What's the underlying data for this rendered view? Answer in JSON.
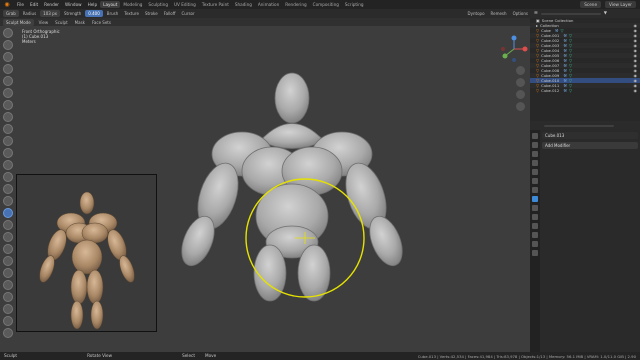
{
  "topbar": {
    "menus": [
      "File",
      "Edit",
      "Render",
      "Window",
      "Help"
    ],
    "workspaces": [
      "Layout",
      "Modeling",
      "Sculpting",
      "UV Editing",
      "Texture Paint",
      "Shading",
      "Animation",
      "Rendering",
      "Compositing",
      "Scripting"
    ],
    "active_workspace": "Layout",
    "scene": "Scene",
    "view_layer": "View Layer"
  },
  "tool_header": {
    "brush": "Grab",
    "radius_label": "Radius",
    "radius_value": "103 px",
    "strength_label": "Strength",
    "strength_value": "0.400",
    "menus": [
      "Brush",
      "Texture",
      "Stroke",
      "Falloff",
      "Cursor"
    ],
    "right": [
      "Dyntopo",
      "Remesh",
      "Options"
    ]
  },
  "viewport_header": {
    "mode": "Sculpt Mode",
    "menus": [
      "View",
      "Sculpt",
      "Mask",
      "Face Sets"
    ]
  },
  "viewport": {
    "view_name": "Front Orthographic",
    "object_name": "(1) Cube.013",
    "units": "Meters"
  },
  "outliner": {
    "header_search": "",
    "rows": [
      {
        "name": "Scene Collection",
        "type": "scene"
      },
      {
        "name": "Collection",
        "type": "collection"
      },
      {
        "name": "Cube",
        "type": "mesh"
      },
      {
        "name": "Cube.001",
        "type": "mesh"
      },
      {
        "name": "Cube.002",
        "type": "mesh"
      },
      {
        "name": "Cube.003",
        "type": "mesh"
      },
      {
        "name": "Cube.004",
        "type": "mesh"
      },
      {
        "name": "Cube.005",
        "type": "mesh"
      },
      {
        "name": "Cube.006",
        "type": "mesh"
      },
      {
        "name": "Cube.007",
        "type": "mesh"
      },
      {
        "name": "Cube.008",
        "type": "mesh"
      },
      {
        "name": "Cube.009",
        "type": "mesh"
      },
      {
        "name": "Cube.010",
        "type": "mesh",
        "selected": true
      },
      {
        "name": "Cube.011",
        "type": "mesh"
      },
      {
        "name": "Cube.012",
        "type": "mesh"
      }
    ]
  },
  "properties": {
    "object": "Cube.013",
    "add_modifier": "Add Modifier"
  },
  "statusbar": {
    "left": "Sculpt",
    "mid1": "Rotate View",
    "mid2": "Select",
    "mid3": "Move",
    "stats": "Cube.013 | Verts:42,534 | Faces:41,984 | Tris:83,978 | Objects:1/13 | Memory: 56.1 MiB | VRAM: 1.0/11.0 GiB | 2.90"
  },
  "colors": {
    "accent": "#4772b3",
    "brush_circle": "#e6e200",
    "logo": "#e87d0d"
  }
}
